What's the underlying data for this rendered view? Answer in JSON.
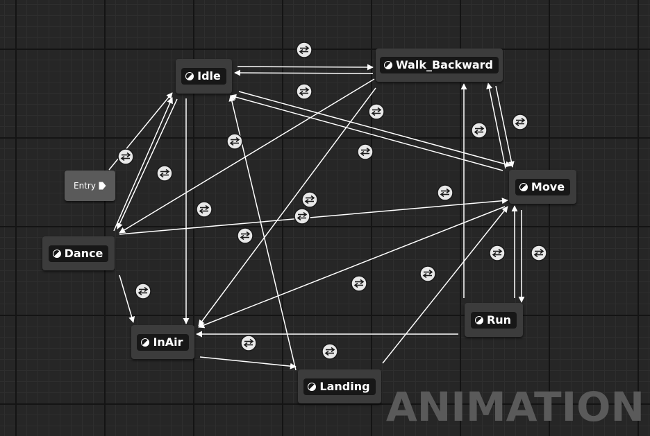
{
  "graph": {
    "watermark": "ANIMATION",
    "wire_color": "#ffffff",
    "entry": {
      "label": "Entry"
    },
    "states": [
      {
        "id": "idle",
        "label": "Idle"
      },
      {
        "id": "walk_backward",
        "label": "Walk_Backward"
      },
      {
        "id": "move",
        "label": "Move"
      },
      {
        "id": "dance",
        "label": "Dance"
      },
      {
        "id": "inair",
        "label": "InAir"
      },
      {
        "id": "landing",
        "label": "Landing"
      },
      {
        "id": "run",
        "label": "Run"
      }
    ],
    "transitions": [
      {
        "from": "Entry",
        "to": "Idle"
      },
      {
        "from": "Idle",
        "to": "Walk_Backward"
      },
      {
        "from": "Walk_Backward",
        "to": "Idle"
      },
      {
        "from": "Idle",
        "to": "Move"
      },
      {
        "from": "Move",
        "to": "Idle"
      },
      {
        "from": "Idle",
        "to": "Dance"
      },
      {
        "from": "Dance",
        "to": "Idle"
      },
      {
        "from": "Idle",
        "to": "InAir"
      },
      {
        "from": "Landing",
        "to": "Idle"
      },
      {
        "from": "Walk_Backward",
        "to": "Dance"
      },
      {
        "from": "Dance",
        "to": "Move"
      },
      {
        "from": "Dance",
        "to": "InAir"
      },
      {
        "from": "Walk_Backward",
        "to": "InAir"
      },
      {
        "from": "Walk_Backward",
        "to": "Move"
      },
      {
        "from": "Move",
        "to": "Walk_Backward"
      },
      {
        "from": "Run",
        "to": "Walk_Backward"
      },
      {
        "from": "Move",
        "to": "InAir"
      },
      {
        "from": "Move",
        "to": "Run"
      },
      {
        "from": "Run",
        "to": "Move"
      },
      {
        "from": "Run",
        "to": "InAir"
      },
      {
        "from": "InAir",
        "to": "Landing"
      },
      {
        "from": "Landing",
        "to": "Move"
      }
    ]
  }
}
